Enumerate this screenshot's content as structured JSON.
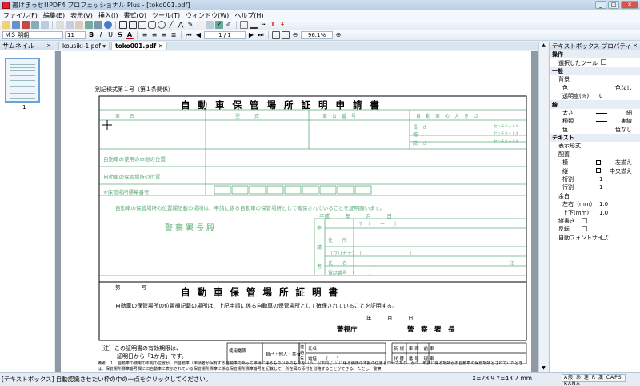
{
  "window": {
    "title": "書けまっせ!!PDF4 プロフェッショナル Plus - [toko001.pdf]"
  },
  "menu": [
    "ファイル(F)",
    "編集(E)",
    "表示(V)",
    "挿入(I)",
    "書式(O)",
    "ツール(T)",
    "ウィンドウ(W)",
    "ヘルプ(H)"
  ],
  "toolbar": {
    "font_name": "ＭＳ 明朝",
    "font_size": "11",
    "bold": "B",
    "italic": "I",
    "underline": "U",
    "strike": "S",
    "page_indicator": "1 / 1",
    "zoom": "96.1%"
  },
  "left_panel": {
    "title": "サムネイル",
    "close": "×",
    "page_label": "1"
  },
  "tabs": [
    "kousiki-1.pdf",
    "toko001.pdf"
  ],
  "document": {
    "form_number": "別記様式第１号（第１条関係）",
    "title": "自動車保管場所証明申請書",
    "head_cols": [
      "車　　名",
      "型　　　式",
      "車　台　番　号",
      "自　動　車　の　大　き　さ"
    ],
    "dims": [
      "長　さ",
      "幅",
      "高　さ"
    ],
    "dim_unit": "センチメートル",
    "row_base": "自動車の使用の本拠の位置",
    "row_storage": "自動車の保管場所の位置",
    "row_sign": "※保管場所標章番号",
    "cert_statement": "自動車の保管場所の位置欄記載の場所は、申請に係る自動車の保管場所として確保されていることを証明願います。",
    "era": "平成　　　年　　　月　　　日",
    "police_chief": "警察署長殿",
    "applicant": [
      "申",
      "請",
      "者"
    ],
    "addr_rows": [
      "〒　（　　ー　　）",
      "住　　所",
      "（フリガナ）　（　　　　　　　　　　）",
      "氏　　名",
      "電話番号　（　　　）"
    ],
    "seal": "印",
    "num_label": "第　　　　号",
    "cert_title": "自動車保管場所証明書",
    "cert_body": "自動車の保管場所の位置欄記載の場所は、上記申請に係る自動車の保管場所として確保されていることを証明する。",
    "cert_date": "年　　　月　　　日",
    "office": "警視庁",
    "chief": "警　察　署　長",
    "note1": "［注］この証明書の有効期限は、",
    "note2": "証明日から「1か月」です。",
    "usage_label": "使用権限",
    "usage_value": "自己・他人・共有",
    "contact_label": "連絡先",
    "contact_rows": [
      "氏名",
      "電話　　（　　）"
    ],
    "right_grid": [
      "新規 車両 前車",
      "代替 番号 現車"
    ],
    "remarks": "備考　１　自動車の使用の本拠の位置が、旧自動車（申請者が保有する自動車であって申請に係るもの以外のものをいう。以下同じ。）に係る使用の本拠の位置と同一であり、かつ、申請に係る場所が旧自動車の保管場所とされていたときは、保管場所標章番号欄に旧自動車に表示されている保管場所標章に係る保管場所標章番号を記載して、所在図の添付を省略することができる。ただし、警察"
  },
  "right_panel": {
    "title": "テキストボックス プロパティ",
    "rows": [
      {
        "type": "cat",
        "label": "操作"
      },
      {
        "type": "check",
        "label": "選択したツール"
      },
      {
        "type": "cat",
        "label": "一般"
      },
      {
        "type": "sub",
        "label": "背景"
      },
      {
        "type": "val",
        "label": "色",
        "value": "色なし"
      },
      {
        "type": "val",
        "label": "透明度(%)",
        "value": "0"
      },
      {
        "type": "cat",
        "label": "線"
      },
      {
        "type": "line",
        "label": "太さ",
        "value": "細"
      },
      {
        "type": "line",
        "label": "種類",
        "value": "実線"
      },
      {
        "type": "val",
        "label": "色",
        "value": "色なし"
      },
      {
        "type": "cat",
        "label": "テキスト"
      },
      {
        "type": "sub",
        "label": "表示形式"
      },
      {
        "type": "sub",
        "label": "配置"
      },
      {
        "type": "align",
        "label": "横",
        "value": "左揃え"
      },
      {
        "type": "align",
        "label": "縦",
        "value": "中央揃え"
      },
      {
        "type": "val",
        "label": "桁割",
        "value": "1"
      },
      {
        "type": "val",
        "label": "行割",
        "value": "1"
      },
      {
        "type": "sub",
        "label": "余白"
      },
      {
        "type": "val",
        "label": "左右（mm）",
        "value": "1.0"
      },
      {
        "type": "val",
        "label": "上下(mm)",
        "value": "1.0"
      },
      {
        "type": "check",
        "label": "縦書き"
      },
      {
        "type": "check",
        "label": "反転"
      },
      {
        "type": "check",
        "label": "自動フォントサイズ"
      }
    ]
  },
  "status": {
    "message": "[テキストボックス] 自動認識させたい枠の中の一点をクリックしてください。",
    "coords": "X=28.9 Y=43.2 mm",
    "ime": "A般 あ 連 R 漢 CAPS KANA"
  },
  "colors": {
    "form_green": "#5fae7a",
    "panel_header": "#d3dfec"
  }
}
